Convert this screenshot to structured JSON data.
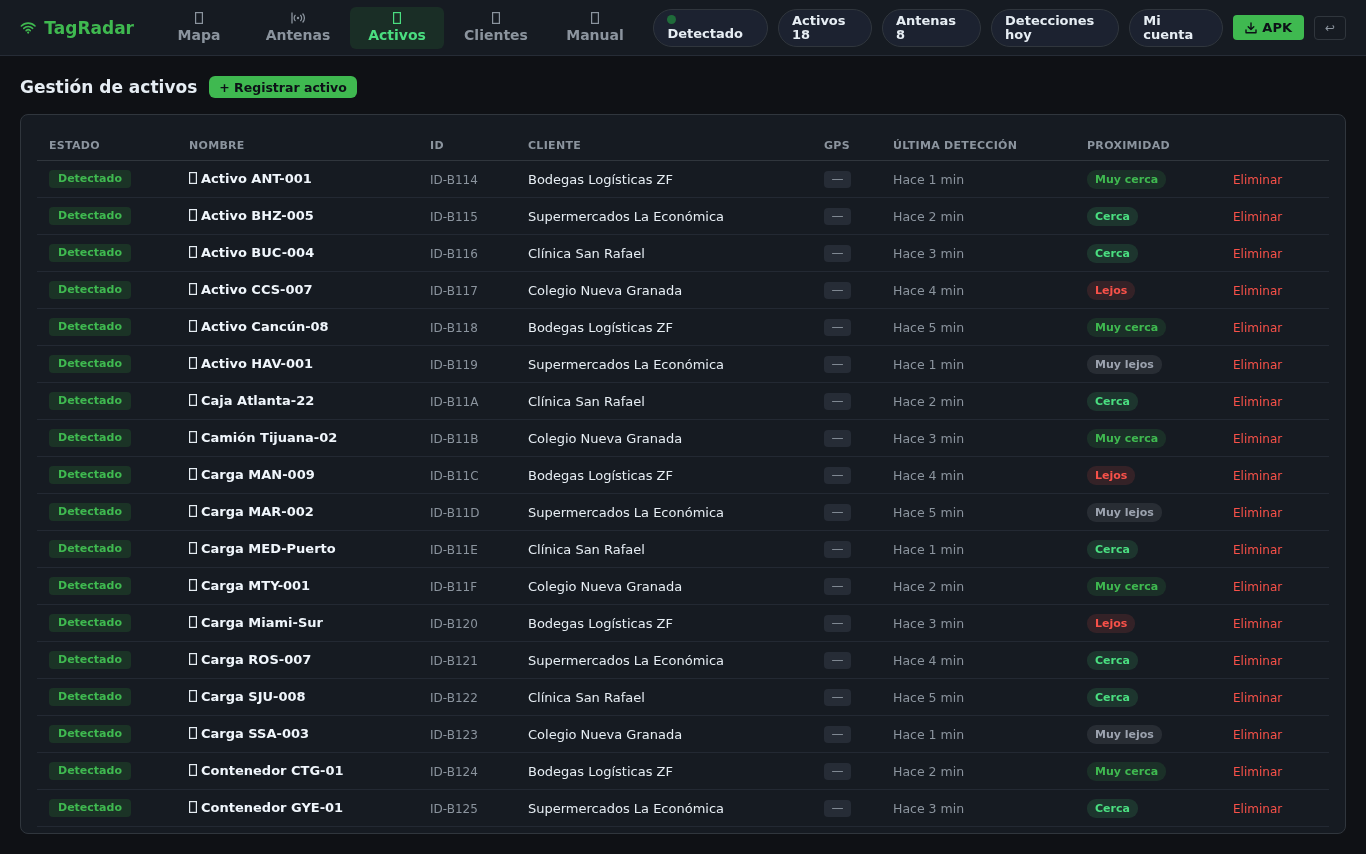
{
  "app": {
    "name": "TagRadar"
  },
  "nav": [
    {
      "label": "Mapa",
      "selected": false
    },
    {
      "label": "Antenas",
      "selected": false
    },
    {
      "label": "Activos",
      "selected": true
    },
    {
      "label": "Clientes",
      "selected": false
    },
    {
      "label": "Manual",
      "selected": false
    }
  ],
  "status_pill": {
    "label": "Detectado"
  },
  "stats": [
    "Activos 18",
    "Antenas 8",
    "Detecciones hoy"
  ],
  "account_button": "Mi cuenta",
  "apk_button": "APK",
  "logout_button": "↩",
  "page_title": "Gestión de activos",
  "register_button": "+ Registrar activo",
  "table": {
    "columns": [
      "ESTADO",
      "NOMBRE",
      "ID",
      "CLIENTE",
      "GPS",
      "ÚLTIMA DETECCIÓN",
      "PROXIMIDAD"
    ],
    "rows": [
      {
        "status": "Detectado",
        "name": "Activo ANT-001",
        "id": "ID-B114",
        "client": "Bodegas Logísticas ZF",
        "gps": "—",
        "last_seen": "Hace 1 min",
        "proximity": {
          "label": "Muy cerca",
          "color": "#3fb950"
        },
        "action": "Eliminar"
      },
      {
        "status": "Detectado",
        "name": "Activo BHZ-005",
        "id": "ID-B115",
        "client": "Supermercados La Económica",
        "gps": "—",
        "last_seen": "Hace 2 min",
        "proximity": {
          "label": "Cerca",
          "color": "#4ade80"
        },
        "action": "Eliminar"
      },
      {
        "status": "Detectado",
        "name": "Activo BUC-004",
        "id": "ID-B116",
        "client": "Clínica San Rafael",
        "gps": "—",
        "last_seen": "Hace 3 min",
        "proximity": {
          "label": "Cerca",
          "color": "#4ade80"
        },
        "action": "Eliminar"
      },
      {
        "status": "Detectado",
        "name": "Activo CCS-007",
        "id": "ID-B117",
        "client": "Colegio Nueva Granada",
        "gps": "—",
        "last_seen": "Hace 4 min",
        "proximity": {
          "label": "Lejos",
          "color": "#f85149"
        },
        "action": "Eliminar"
      },
      {
        "status": "Detectado",
        "name": "Activo Cancún-08",
        "id": "ID-B118",
        "client": "Bodegas Logísticas ZF",
        "gps": "—",
        "last_seen": "Hace 5 min",
        "proximity": {
          "label": "Muy cerca",
          "color": "#3fb950"
        },
        "action": "Eliminar"
      },
      {
        "status": "Detectado",
        "name": "Activo HAV-001",
        "id": "ID-B119",
        "client": "Supermercados La Económica",
        "gps": "—",
        "last_seen": "Hace 1 min",
        "proximity": {
          "label": "Muy lejos",
          "color": "#9ca3af"
        },
        "action": "Eliminar"
      },
      {
        "status": "Detectado",
        "name": "Caja Atlanta-22",
        "id": "ID-B11A",
        "client": "Clínica San Rafael",
        "gps": "—",
        "last_seen": "Hace 2 min",
        "proximity": {
          "label": "Cerca",
          "color": "#4ade80"
        },
        "action": "Eliminar"
      },
      {
        "status": "Detectado",
        "name": "Camión Tijuana-02",
        "id": "ID-B11B",
        "client": "Colegio Nueva Granada",
        "gps": "—",
        "last_seen": "Hace 3 min",
        "proximity": {
          "label": "Muy cerca",
          "color": "#3fb950"
        },
        "action": "Eliminar"
      },
      {
        "status": "Detectado",
        "name": "Carga MAN-009",
        "id": "ID-B11C",
        "client": "Bodegas Logísticas ZF",
        "gps": "—",
        "last_seen": "Hace 4 min",
        "proximity": {
          "label": "Lejos",
          "color": "#f85149"
        },
        "action": "Eliminar"
      },
      {
        "status": "Detectado",
        "name": "Carga MAR-002",
        "id": "ID-B11D",
        "client": "Supermercados La Económica",
        "gps": "—",
        "last_seen": "Hace 5 min",
        "proximity": {
          "label": "Muy lejos",
          "color": "#9ca3af"
        },
        "action": "Eliminar"
      },
      {
        "status": "Detectado",
        "name": "Carga MED-Puerto",
        "id": "ID-B11E",
        "client": "Clínica San Rafael",
        "gps": "—",
        "last_seen": "Hace 1 min",
        "proximity": {
          "label": "Cerca",
          "color": "#4ade80"
        },
        "action": "Eliminar"
      },
      {
        "status": "Detectado",
        "name": "Carga MTY-001",
        "id": "ID-B11F",
        "client": "Colegio Nueva Granada",
        "gps": "—",
        "last_seen": "Hace 2 min",
        "proximity": {
          "label": "Muy cerca",
          "color": "#3fb950"
        },
        "action": "Eliminar"
      },
      {
        "status": "Detectado",
        "name": "Carga Miami-Sur",
        "id": "ID-B120",
        "client": "Bodegas Logísticas ZF",
        "gps": "—",
        "last_seen": "Hace 3 min",
        "proximity": {
          "label": "Lejos",
          "color": "#f85149"
        },
        "action": "Eliminar"
      },
      {
        "status": "Detectado",
        "name": "Carga ROS-007",
        "id": "ID-B121",
        "client": "Supermercados La Económica",
        "gps": "—",
        "last_seen": "Hace 4 min",
        "proximity": {
          "label": "Cerca",
          "color": "#4ade80"
        },
        "action": "Eliminar"
      },
      {
        "status": "Detectado",
        "name": "Carga SJU-008",
        "id": "ID-B122",
        "client": "Clínica San Rafael",
        "gps": "—",
        "last_seen": "Hace 5 min",
        "proximity": {
          "label": "Cerca",
          "color": "#4ade80"
        },
        "action": "Eliminar"
      },
      {
        "status": "Detectado",
        "name": "Carga SSA-003",
        "id": "ID-B123",
        "client": "Colegio Nueva Granada",
        "gps": "—",
        "last_seen": "Hace 1 min",
        "proximity": {
          "label": "Muy lejos",
          "color": "#9ca3af"
        },
        "action": "Eliminar"
      },
      {
        "status": "Detectado",
        "name": "Contenedor CTG-01",
        "id": "ID-B124",
        "client": "Bodegas Logísticas ZF",
        "gps": "—",
        "last_seen": "Hace 2 min",
        "proximity": {
          "label": "Muy cerca",
          "color": "#3fb950"
        },
        "action": "Eliminar"
      },
      {
        "status": "Detectado",
        "name": "Contenedor GYE-01",
        "id": "ID-B125",
        "client": "Supermercados La Económica",
        "gps": "—",
        "last_seen": "Hace 3 min",
        "proximity": {
          "label": "Cerca",
          "color": "#4ade80"
        },
        "action": "Eliminar"
      }
    ]
  }
}
